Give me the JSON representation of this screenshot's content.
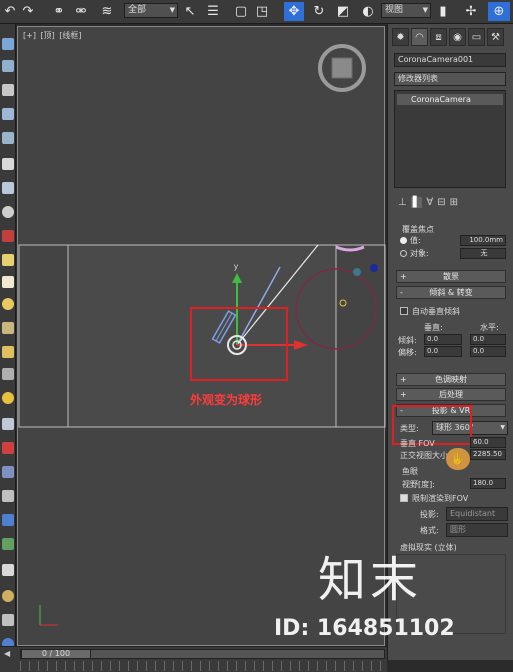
{
  "toolbar": {
    "selection_filter": "全部",
    "reference_coord": "视图"
  },
  "viewport": {
    "label_plus": "[+]",
    "label_view": "[顶]",
    "label_shading": "[线框]",
    "annotation": "外观变为球形"
  },
  "panel": {
    "object_name": "CoronaCamera001",
    "modifier_list": "修改器列表",
    "stack_item": "CoronaCamera",
    "focus_header": "覆盖焦点",
    "value_label": "值:",
    "value_field": "100.0mm",
    "object_label": "对象:",
    "object_field": "无",
    "rollout_dof": "散景",
    "rollout_tilt": "倾斜 & 转变",
    "auto_vertical_tilt": "自动垂直倾斜",
    "vertical_label": "垂直:",
    "horizontal_label": "水平:",
    "tilt_label": "倾斜:",
    "tilt_v": "0.0",
    "tilt_h": "0.0",
    "shift_label": "偏移:",
    "shift_v": "0.0",
    "shift_h": "0.0",
    "rollout_tonemap": "色调映射",
    "rollout_post": "后处理",
    "rollout_projection": "投影 & VR",
    "type_label": "类型:",
    "type_value": "球形 360°",
    "vfov_label": "垂直 FOV",
    "vfov_value": "60.0",
    "ortho_label": "正交视图大小",
    "ortho_value": "2285.50",
    "fisheye_header": "鱼眼",
    "fov_label": "视野[度]:",
    "fov_value": "180.0",
    "restrict_label": "限制渲染到FOV",
    "projection_label": "投影:",
    "projection_value": "Equidistant",
    "format_label": "格式:",
    "format_value": "圆形",
    "vr_header": "虚拟现实 (立体)"
  },
  "timeline": {
    "frame": "0 / 100"
  },
  "watermark": {
    "brand": "知末",
    "id_text": "ID: 164851102"
  },
  "colors": {
    "annotation_red": "#e02020",
    "selection_blue": "#2f6fd8",
    "axis_green": "#3fbf3f",
    "axis_red": "#e03030"
  }
}
